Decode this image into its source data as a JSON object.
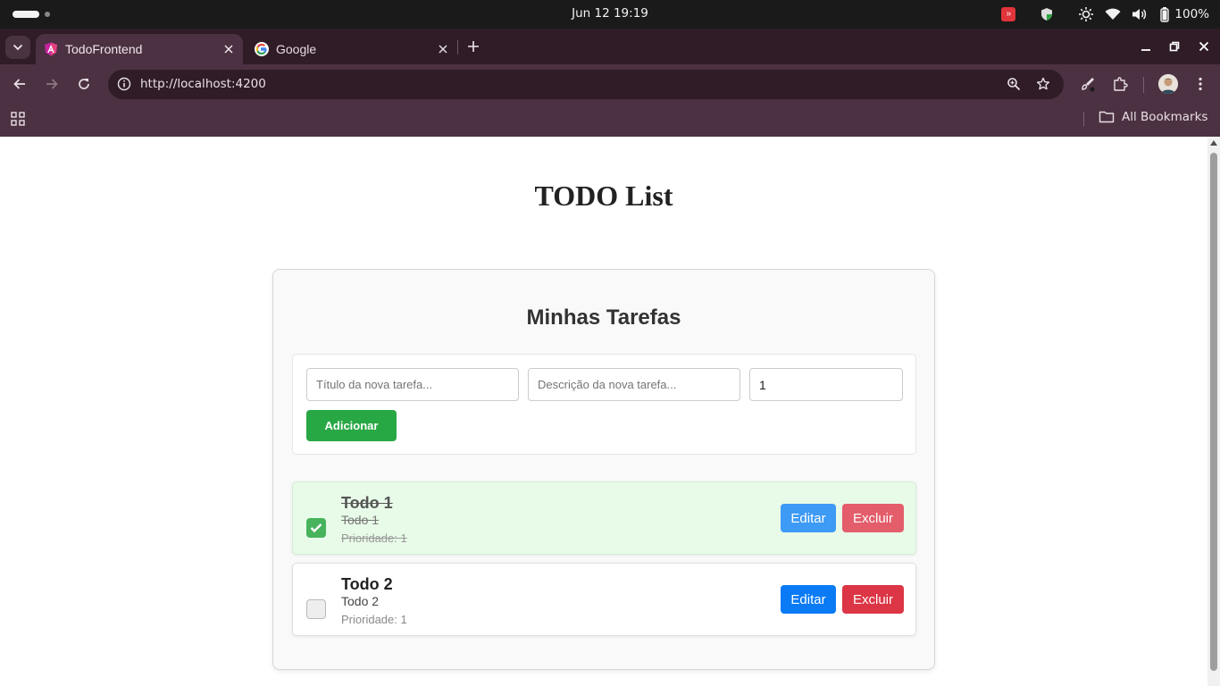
{
  "os": {
    "clock": "Jun 12  19:19",
    "battery": "100%"
  },
  "browser": {
    "tabs": [
      {
        "title": "TodoFrontend",
        "active": true,
        "favicon": "angular-icon"
      },
      {
        "title": "Google",
        "active": false,
        "favicon": "google-icon"
      }
    ],
    "url": "http://localhost:4200",
    "bookmarks_label": "All Bookmarks",
    "theme": {
      "frame": "#2f1c27",
      "toolbar": "#4b3141"
    }
  },
  "page": {
    "heading": "TODO List",
    "card_title": "Minhas Tarefas",
    "form": {
      "title_placeholder": "Título da nova tarefa...",
      "description_placeholder": "Descrição da nova tarefa...",
      "priority_value": "1",
      "add_label": "Adicionar"
    },
    "todos": [
      {
        "title": "Todo 1",
        "description": "Todo 1",
        "priority": "Prioridade: 1",
        "completed": true,
        "edit_label": "Editar",
        "delete_label": "Excluir"
      },
      {
        "title": "Todo 2",
        "description": "Todo 2",
        "priority": "Prioridade: 1",
        "completed": false,
        "edit_label": "Editar",
        "delete_label": "Excluir"
      }
    ],
    "colors": {
      "add": "#28a745",
      "edit": "#0a7bf5",
      "delete": "#dc3545",
      "done_bg": "#e8fbe8",
      "check_on": "#47b35d"
    }
  }
}
